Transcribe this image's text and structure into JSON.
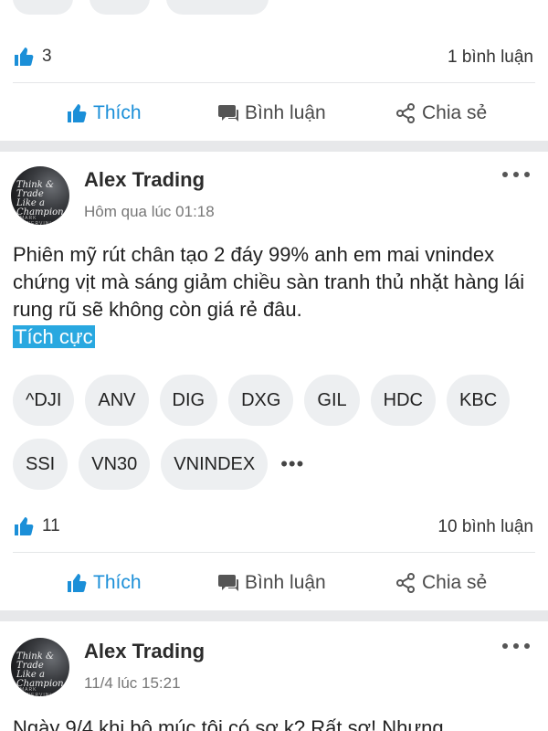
{
  "post0": {
    "likes": "3",
    "comments": "1 bình luận"
  },
  "actions": {
    "like": "Thích",
    "comment": "Bình luận",
    "share": "Chia sẻ"
  },
  "post1": {
    "author": "Alex Trading",
    "time": "Hôm qua lúc 01:18",
    "avatar_text": "Think & Trade Like a Champion",
    "avatar_small": "MARK MINERVINI",
    "body": "Phiên mỹ rút chân tạo 2 đáy 99% anh em mai vnindex chứng vịt mà sáng giảm chiều sàn tranh thủ nhặt hàng lái rung rũ sẽ không còn giá rẻ đâu.",
    "sentiment": "Tích cực",
    "tags_row1": [
      "^DJI",
      "ANV",
      "DIG",
      "DXG",
      "GIL",
      "HDC",
      "KBC"
    ],
    "tags_row2": [
      "SSI",
      "VN30",
      "VNINDEX"
    ],
    "tags_more": "•••",
    "likes": "11",
    "comments": "10 bình luận"
  },
  "post2": {
    "author": "Alex Trading",
    "time": "11/4 lúc 15:21",
    "avatar_text": "Think & Trade Like a Champion",
    "avatar_small": "MARK MINERVINI",
    "body_partial": "Ngày 9/4 khi bộ múc tôi có sợ k? Rất sợ! Nhưng"
  },
  "colors": {
    "accent": "#1b8fd8",
    "sentiment_bg": "#29a8e0",
    "chip_bg": "#edeff1",
    "separator": "#e7e8ea"
  },
  "icons": [
    "thumbs-up-icon",
    "comment-bubble-icon",
    "share-icon",
    "more-dots-icon"
  ]
}
